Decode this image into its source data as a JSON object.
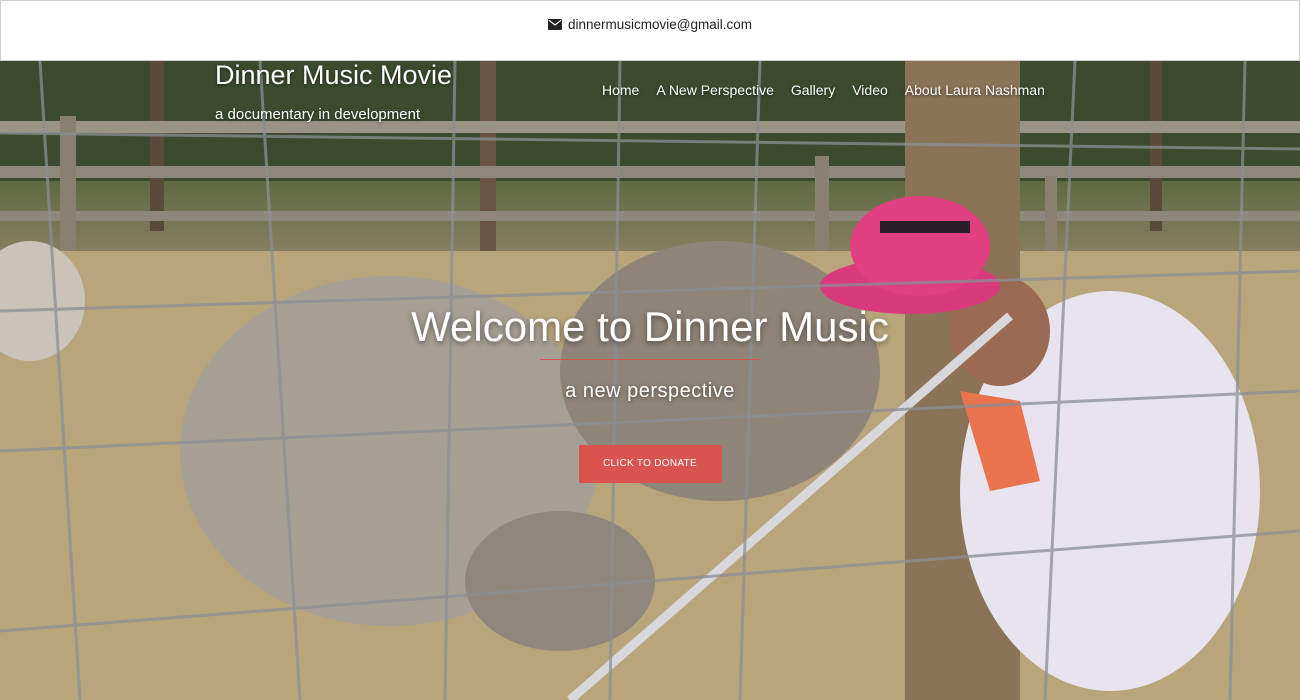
{
  "topbar": {
    "email": "dinnermusicmovie@gmail.com",
    "icon": "envelope-icon"
  },
  "header": {
    "site_title": "Dinner Music Movie",
    "tagline": "a documentary in development"
  },
  "nav": {
    "items": [
      {
        "label": "Home"
      },
      {
        "label": "A New Perspective"
      },
      {
        "label": "Gallery"
      },
      {
        "label": "Video"
      },
      {
        "label": "About Laura Nashman"
      }
    ]
  },
  "hero": {
    "heading": "Welcome to Dinner Music",
    "subheading": "a new perspective",
    "cta_label": "CLICK TO DONATE",
    "image_description": "Woman in pink hat playing flute to pigs behind wire fence"
  },
  "colors": {
    "accent": "#d9534f",
    "text_light": "#ffffff",
    "text_dark": "#222222"
  }
}
